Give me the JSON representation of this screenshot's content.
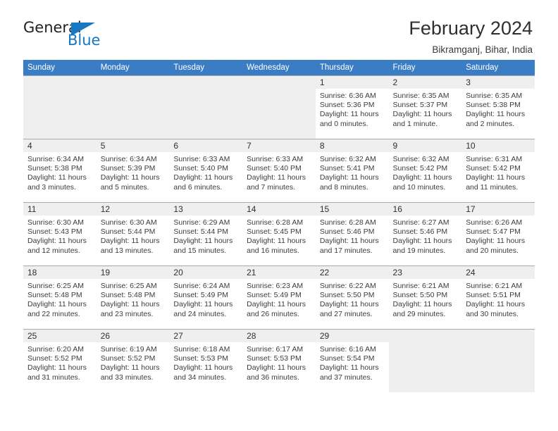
{
  "brand": {
    "name_part1": "General",
    "name_part2": "Blue",
    "triangle_icon": "triangle-icon",
    "accent_color": "#1678c2"
  },
  "header": {
    "title": "February 2024",
    "subtitle": "Bikramganj, Bihar, India",
    "header_bg_color": "#3b7dc4",
    "daynum_bg_color": "#efefef"
  },
  "weekdays": [
    "Sunday",
    "Monday",
    "Tuesday",
    "Wednesday",
    "Thursday",
    "Friday",
    "Saturday"
  ],
  "weeks": [
    [
      {
        "day": "",
        "sunrise": "",
        "sunset": "",
        "daylight1": "",
        "daylight2": "",
        "empty": true
      },
      {
        "day": "",
        "sunrise": "",
        "sunset": "",
        "daylight1": "",
        "daylight2": "",
        "empty": true
      },
      {
        "day": "",
        "sunrise": "",
        "sunset": "",
        "daylight1": "",
        "daylight2": "",
        "empty": true
      },
      {
        "day": "",
        "sunrise": "",
        "sunset": "",
        "daylight1": "",
        "daylight2": "",
        "empty": true
      },
      {
        "day": "1",
        "sunrise": "Sunrise: 6:36 AM",
        "sunset": "Sunset: 5:36 PM",
        "daylight1": "Daylight: 11 hours",
        "daylight2": "and 0 minutes.",
        "empty": false
      },
      {
        "day": "2",
        "sunrise": "Sunrise: 6:35 AM",
        "sunset": "Sunset: 5:37 PM",
        "daylight1": "Daylight: 11 hours",
        "daylight2": "and 1 minute.",
        "empty": false
      },
      {
        "day": "3",
        "sunrise": "Sunrise: 6:35 AM",
        "sunset": "Sunset: 5:38 PM",
        "daylight1": "Daylight: 11 hours",
        "daylight2": "and 2 minutes.",
        "empty": false
      }
    ],
    [
      {
        "day": "4",
        "sunrise": "Sunrise: 6:34 AM",
        "sunset": "Sunset: 5:38 PM",
        "daylight1": "Daylight: 11 hours",
        "daylight2": "and 3 minutes.",
        "empty": false
      },
      {
        "day": "5",
        "sunrise": "Sunrise: 6:34 AM",
        "sunset": "Sunset: 5:39 PM",
        "daylight1": "Daylight: 11 hours",
        "daylight2": "and 5 minutes.",
        "empty": false
      },
      {
        "day": "6",
        "sunrise": "Sunrise: 6:33 AM",
        "sunset": "Sunset: 5:40 PM",
        "daylight1": "Daylight: 11 hours",
        "daylight2": "and 6 minutes.",
        "empty": false
      },
      {
        "day": "7",
        "sunrise": "Sunrise: 6:33 AM",
        "sunset": "Sunset: 5:40 PM",
        "daylight1": "Daylight: 11 hours",
        "daylight2": "and 7 minutes.",
        "empty": false
      },
      {
        "day": "8",
        "sunrise": "Sunrise: 6:32 AM",
        "sunset": "Sunset: 5:41 PM",
        "daylight1": "Daylight: 11 hours",
        "daylight2": "and 8 minutes.",
        "empty": false
      },
      {
        "day": "9",
        "sunrise": "Sunrise: 6:32 AM",
        "sunset": "Sunset: 5:42 PM",
        "daylight1": "Daylight: 11 hours",
        "daylight2": "and 10 minutes.",
        "empty": false
      },
      {
        "day": "10",
        "sunrise": "Sunrise: 6:31 AM",
        "sunset": "Sunset: 5:42 PM",
        "daylight1": "Daylight: 11 hours",
        "daylight2": "and 11 minutes.",
        "empty": false
      }
    ],
    [
      {
        "day": "11",
        "sunrise": "Sunrise: 6:30 AM",
        "sunset": "Sunset: 5:43 PM",
        "daylight1": "Daylight: 11 hours",
        "daylight2": "and 12 minutes.",
        "empty": false
      },
      {
        "day": "12",
        "sunrise": "Sunrise: 6:30 AM",
        "sunset": "Sunset: 5:44 PM",
        "daylight1": "Daylight: 11 hours",
        "daylight2": "and 13 minutes.",
        "empty": false
      },
      {
        "day": "13",
        "sunrise": "Sunrise: 6:29 AM",
        "sunset": "Sunset: 5:44 PM",
        "daylight1": "Daylight: 11 hours",
        "daylight2": "and 15 minutes.",
        "empty": false
      },
      {
        "day": "14",
        "sunrise": "Sunrise: 6:28 AM",
        "sunset": "Sunset: 5:45 PM",
        "daylight1": "Daylight: 11 hours",
        "daylight2": "and 16 minutes.",
        "empty": false
      },
      {
        "day": "15",
        "sunrise": "Sunrise: 6:28 AM",
        "sunset": "Sunset: 5:46 PM",
        "daylight1": "Daylight: 11 hours",
        "daylight2": "and 17 minutes.",
        "empty": false
      },
      {
        "day": "16",
        "sunrise": "Sunrise: 6:27 AM",
        "sunset": "Sunset: 5:46 PM",
        "daylight1": "Daylight: 11 hours",
        "daylight2": "and 19 minutes.",
        "empty": false
      },
      {
        "day": "17",
        "sunrise": "Sunrise: 6:26 AM",
        "sunset": "Sunset: 5:47 PM",
        "daylight1": "Daylight: 11 hours",
        "daylight2": "and 20 minutes.",
        "empty": false
      }
    ],
    [
      {
        "day": "18",
        "sunrise": "Sunrise: 6:25 AM",
        "sunset": "Sunset: 5:48 PM",
        "daylight1": "Daylight: 11 hours",
        "daylight2": "and 22 minutes.",
        "empty": false
      },
      {
        "day": "19",
        "sunrise": "Sunrise: 6:25 AM",
        "sunset": "Sunset: 5:48 PM",
        "daylight1": "Daylight: 11 hours",
        "daylight2": "and 23 minutes.",
        "empty": false
      },
      {
        "day": "20",
        "sunrise": "Sunrise: 6:24 AM",
        "sunset": "Sunset: 5:49 PM",
        "daylight1": "Daylight: 11 hours",
        "daylight2": "and 24 minutes.",
        "empty": false
      },
      {
        "day": "21",
        "sunrise": "Sunrise: 6:23 AM",
        "sunset": "Sunset: 5:49 PM",
        "daylight1": "Daylight: 11 hours",
        "daylight2": "and 26 minutes.",
        "empty": false
      },
      {
        "day": "22",
        "sunrise": "Sunrise: 6:22 AM",
        "sunset": "Sunset: 5:50 PM",
        "daylight1": "Daylight: 11 hours",
        "daylight2": "and 27 minutes.",
        "empty": false
      },
      {
        "day": "23",
        "sunrise": "Sunrise: 6:21 AM",
        "sunset": "Sunset: 5:50 PM",
        "daylight1": "Daylight: 11 hours",
        "daylight2": "and 29 minutes.",
        "empty": false
      },
      {
        "day": "24",
        "sunrise": "Sunrise: 6:21 AM",
        "sunset": "Sunset: 5:51 PM",
        "daylight1": "Daylight: 11 hours",
        "daylight2": "and 30 minutes.",
        "empty": false
      }
    ],
    [
      {
        "day": "25",
        "sunrise": "Sunrise: 6:20 AM",
        "sunset": "Sunset: 5:52 PM",
        "daylight1": "Daylight: 11 hours",
        "daylight2": "and 31 minutes.",
        "empty": false
      },
      {
        "day": "26",
        "sunrise": "Sunrise: 6:19 AM",
        "sunset": "Sunset: 5:52 PM",
        "daylight1": "Daylight: 11 hours",
        "daylight2": "and 33 minutes.",
        "empty": false
      },
      {
        "day": "27",
        "sunrise": "Sunrise: 6:18 AM",
        "sunset": "Sunset: 5:53 PM",
        "daylight1": "Daylight: 11 hours",
        "daylight2": "and 34 minutes.",
        "empty": false
      },
      {
        "day": "28",
        "sunrise": "Sunrise: 6:17 AM",
        "sunset": "Sunset: 5:53 PM",
        "daylight1": "Daylight: 11 hours",
        "daylight2": "and 36 minutes.",
        "empty": false
      },
      {
        "day": "29",
        "sunrise": "Sunrise: 6:16 AM",
        "sunset": "Sunset: 5:54 PM",
        "daylight1": "Daylight: 11 hours",
        "daylight2": "and 37 minutes.",
        "empty": false
      },
      {
        "day": "",
        "sunrise": "",
        "sunset": "",
        "daylight1": "",
        "daylight2": "",
        "empty": true
      },
      {
        "day": "",
        "sunrise": "",
        "sunset": "",
        "daylight1": "",
        "daylight2": "",
        "empty": true
      }
    ]
  ]
}
